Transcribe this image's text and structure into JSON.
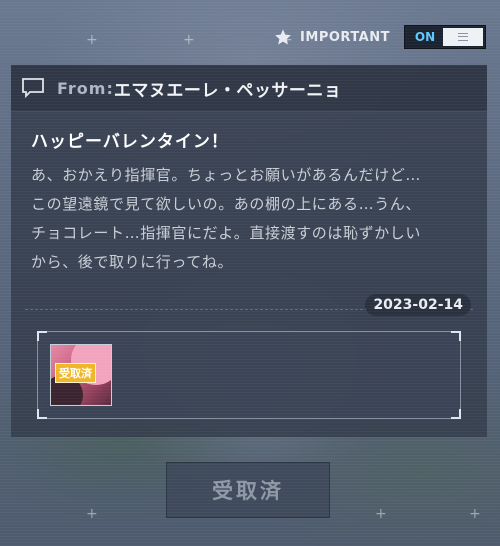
{
  "header": {
    "important_label": "IMPORTANT",
    "toggle_label": "ON",
    "toggle_state": "on"
  },
  "mail": {
    "from_label": "From:",
    "sender": "エマヌエーレ・ペッサーニョ",
    "title": "ハッピーバレンタイン！",
    "body": "あ、おかえり指揮官。ちょっとお願いがあるんだけど…\nこの望遠鏡で見て欲しいの。あの棚の上にある…うん、\nチョコレート…指揮官にだよ。直接渡すのは恥ずかしい\nから、後で取りに行ってね。",
    "date": "2023-02-14"
  },
  "reward": {
    "status_tag": "受取済"
  },
  "claim_button": {
    "label": "受取済",
    "enabled": false
  },
  "colors": {
    "accent": "#5ec8ff",
    "panel": "#343c4c",
    "tag": "#f0b62a"
  },
  "icons": {
    "important": "star-icon",
    "message": "message-icon",
    "toggle": "menu-lines-icon"
  }
}
